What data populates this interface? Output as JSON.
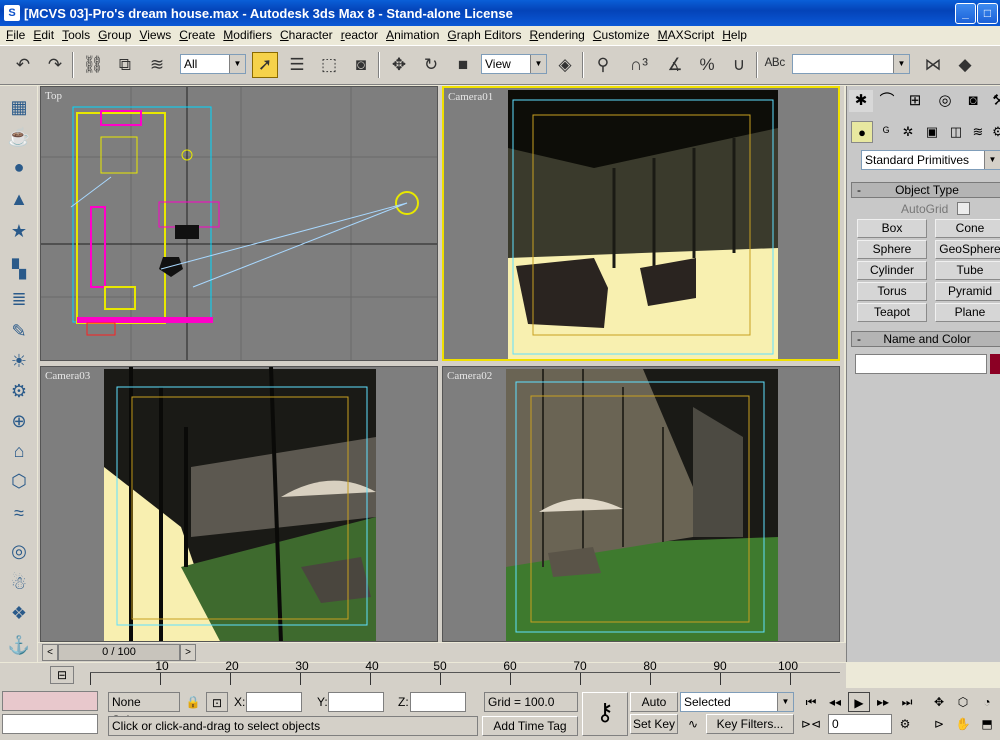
{
  "window": {
    "title": "[MCVS 03]-Pro's dream house.max - Autodesk 3ds Max 8  - Stand-alone License",
    "app_icon": "S",
    "minimize": "_",
    "maximize": "□"
  },
  "menu": [
    "File",
    "Edit",
    "Tools",
    "Group",
    "Views",
    "Create",
    "Modifiers",
    "Character",
    "reactor",
    "Animation",
    "Graph Editors",
    "Rendering",
    "Customize",
    "MAXScript",
    "Help"
  ],
  "toolbar": {
    "selection_filter": "All",
    "reference_coord": "View",
    "named_selection": ""
  },
  "viewports": {
    "top": "Top",
    "camera01": "Camera01",
    "camera03": "Camera03",
    "camera02": "Camera02"
  },
  "command_panel": {
    "category": "Standard Primitives",
    "object_type_header": "Object Type",
    "autogrid_label": "AutoGrid",
    "buttons": [
      "Box",
      "Cone",
      "Sphere",
      "GeoSphere",
      "Cylinder",
      "Tube",
      "Torus",
      "Pyramid",
      "Teapot",
      "Plane"
    ],
    "name_color_header": "Name and Color",
    "name_value": "",
    "object_color": "#8b0024",
    "minus": "-"
  },
  "time": {
    "slider_label": "0 / 100",
    "prev": "<",
    "next": ">",
    "ruler_labels": [
      "10",
      "20",
      "30",
      "40",
      "50",
      "60",
      "70",
      "80",
      "90",
      "100"
    ]
  },
  "status": {
    "selection": "None Selecte",
    "x_label": "X:",
    "y_label": "Y:",
    "z_label": "Z:",
    "x_value": "",
    "y_value": "",
    "z_value": "",
    "grid": "Grid = 100.0",
    "prompt": "Click or click-and-drag to select objects",
    "add_time_tag": "Add Time Tag",
    "auto_key": "Auto Key",
    "set_key": "Set Key",
    "key_mode": "Selected",
    "key_filters": "Key Filters...",
    "current_frame": "0"
  },
  "colors": {
    "active_viewport": "#f0e000",
    "title_blue": "#0a5fd8",
    "viewport_gray": "#7e7e7e"
  }
}
